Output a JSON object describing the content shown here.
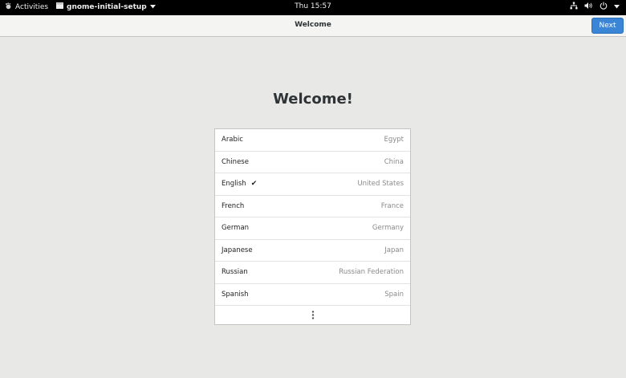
{
  "topbar": {
    "activities": "Activities",
    "app_name": "gnome-initial-setup",
    "clock": "Thu 15:57",
    "icons": [
      "network-icon",
      "volume-icon",
      "power-icon"
    ]
  },
  "header": {
    "title": "Welcome",
    "next_label": "Next",
    "accent": "#3a85d6"
  },
  "main": {
    "heading": "Welcome!",
    "languages": [
      {
        "language": "Arabic",
        "country": "Egypt",
        "selected": false
      },
      {
        "language": "Chinese",
        "country": "China",
        "selected": false
      },
      {
        "language": "English",
        "country": "United States",
        "selected": true
      },
      {
        "language": "French",
        "country": "France",
        "selected": false
      },
      {
        "language": "German",
        "country": "Germany",
        "selected": false
      },
      {
        "language": "Japanese",
        "country": "Japan",
        "selected": false
      },
      {
        "language": "Russian",
        "country": "Russian Federation",
        "selected": false
      },
      {
        "language": "Spanish",
        "country": "Spain",
        "selected": false
      }
    ],
    "check_glyph": "✔"
  }
}
